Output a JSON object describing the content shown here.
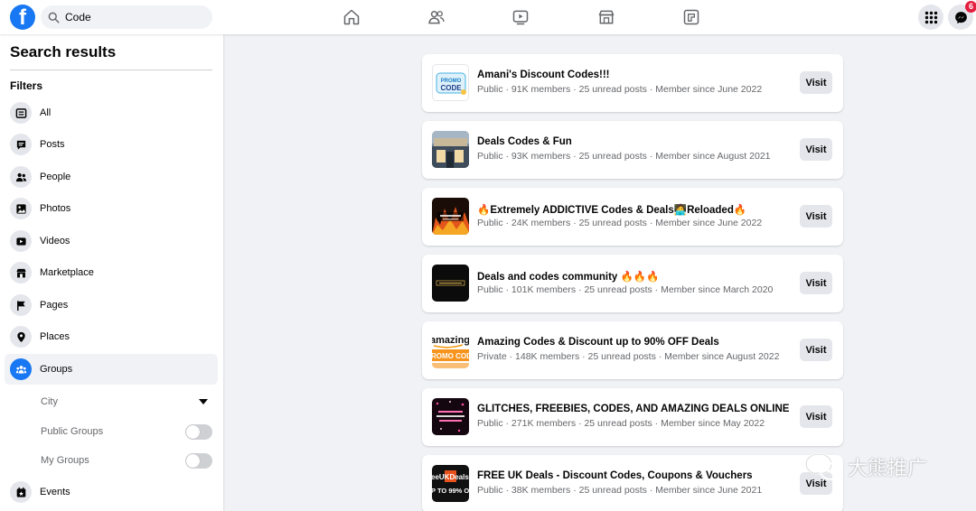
{
  "topbar": {
    "search_value": "Code",
    "nav_icons": [
      "home-icon",
      "friends-icon",
      "watch-icon",
      "marketplace-icon",
      "gaming-icon"
    ],
    "messenger_badge": "6"
  },
  "sidebar": {
    "title": "Search results",
    "filters_label": "Filters",
    "items": [
      {
        "label": "All",
        "icon": "all-icon"
      },
      {
        "label": "Posts",
        "icon": "posts-icon"
      },
      {
        "label": "People",
        "icon": "people-icon"
      },
      {
        "label": "Photos",
        "icon": "photos-icon"
      },
      {
        "label": "Videos",
        "icon": "videos-icon"
      },
      {
        "label": "Marketplace",
        "icon": "marketplace-icon"
      },
      {
        "label": "Pages",
        "icon": "pages-icon"
      },
      {
        "label": "Places",
        "icon": "places-icon"
      },
      {
        "label": "Groups",
        "icon": "groups-icon"
      },
      {
        "label": "Events",
        "icon": "events-icon"
      }
    ],
    "groups_sub": {
      "city_label": "City",
      "public_groups_label": "Public Groups",
      "my_groups_label": "My Groups"
    }
  },
  "results": [
    {
      "name": "Amani's Discount Codes!!!",
      "meta": "Public · 91K members · 25 unread posts · Member since June 2022",
      "visit": "Visit"
    },
    {
      "name": "Deals Codes & Fun",
      "meta": "Public · 93K members · 25 unread posts · Member since August 2021",
      "visit": "Visit"
    },
    {
      "name": "🔥Extremely ADDICTIVE Codes & Deals🧑‍💻Reloaded🔥",
      "meta": "Public · 24K members · 25 unread posts · Member since June 2022",
      "visit": "Visit"
    },
    {
      "name": "Deals and codes community 🔥🔥🔥",
      "meta": "Public · 101K members · 25 unread posts · Member since March 2020",
      "visit": "Visit"
    },
    {
      "name": "Amazing Codes & Discount up to 90% OFF Deals",
      "meta": "Private · 148K members · 25 unread posts · Member since August 2022",
      "visit": "Visit"
    },
    {
      "name": "GLITCHES, FREEBIES, CODES, AND AMAZING DEALS ONLINE",
      "meta": "Public · 271K members · 25 unread posts · Member since May 2022",
      "visit": "Visit"
    },
    {
      "name": "FREE UK Deals - Discount Codes, Coupons & Vouchers",
      "meta": "Public · 38K members · 25 unread posts · Member since June 2021",
      "visit": "Visit"
    }
  ],
  "thumb_text": {
    "promo_1": "PROMO",
    "promo_2": "CODE",
    "amazing": "amazing",
    "promo_code": "ROMO COD",
    "uk_deals": "eeUKDeals",
    "uk_off": "P TO 99% OF"
  },
  "watermark": {
    "text": "大熊推广"
  },
  "colors": {
    "brand": "#1877f2",
    "badge": "#e41e3f"
  }
}
